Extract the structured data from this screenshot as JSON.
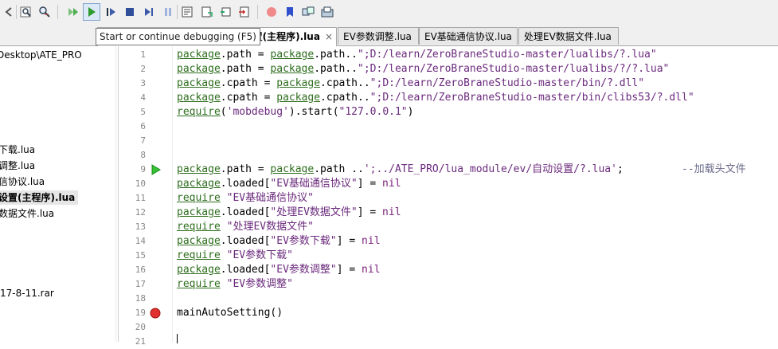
{
  "tooltip": "Start or continue debugging (F5)",
  "toolbar": {
    "icons": [
      "find-icon",
      "find-in-files-icon",
      "run-icon",
      "start-debug-icon",
      "run-to-cursor-icon",
      "stop-icon",
      "step-into-icon",
      "break-icon",
      "watch-icon",
      "stack-icon",
      "outline-icon",
      "console-icon",
      "breakpoint-toggle-icon",
      "bookmark-icon",
      "multi-icon",
      "project-icon"
    ]
  },
  "tabs": [
    {
      "label": "置(主程序).lua",
      "active": true,
      "close": "×"
    },
    {
      "label": "EV参数调整.lua",
      "active": false
    },
    {
      "label": "EV基础通信协议.lua",
      "active": false
    },
    {
      "label": "处理EV数据文件.lua",
      "active": false
    }
  ],
  "sidebar": {
    "items": [
      {
        "label": "Desktop\\ATE_PRO",
        "selected": false
      },
      {
        "label": "下载.lua",
        "selected": false
      },
      {
        "label": "调整.lua",
        "selected": false
      },
      {
        "label": "信协议.lua",
        "selected": false
      },
      {
        "label": "设置(主程序).lua",
        "selected": true
      },
      {
        "label": "数据文件.lua",
        "selected": false
      },
      {
        "label": "17-8-11.rar",
        "selected": false
      }
    ]
  },
  "editor": {
    "line_numbers": [
      "1",
      "2",
      "3",
      "4",
      "5",
      "6",
      "7",
      "8",
      "9",
      "10",
      "11",
      "12",
      "13",
      "14",
      "15",
      "16",
      "17",
      "18",
      "19",
      "20",
      "21"
    ],
    "lines": [
      "package.path = package.path..\";D:/learn/ZeroBraneStudio-master/lualibs/?.lua\"",
      "package.path = package.path..\";D:/learn/ZeroBraneStudio-master/lualibs/?/?.lua\"",
      "package.cpath = package.cpath..\";D:/learn/ZeroBraneStudio-master/bin/?.dll\"",
      "package.cpath = package.cpath..\";D:/learn/ZeroBraneStudio-master/bin/clibs53/?.dll\"",
      "require('mobdebug').start(\"127.0.0.1\")",
      "",
      "",
      "",
      "package.path = package.path ..';../ATE_PRO/lua_module/ev/自动设置/?.lua';",
      "package.loaded[\"EV基础通信协议\"] = nil",
      "require \"EV基础通信协议\"",
      "package.loaded[\"处理EV数据文件\"] = nil",
      "require \"处理EV数据文件\"",
      "package.loaded[\"EV参数下载\"] = nil",
      "require \"EV参数下载\"",
      "package.loaded[\"EV参数调整\"] = nil",
      "require \"EV参数调整\"",
      "",
      "mainAutoSetting()",
      "",
      ""
    ],
    "comment_line9": "--加载头文件",
    "current_line": "9",
    "breakpoint_line": "19"
  }
}
